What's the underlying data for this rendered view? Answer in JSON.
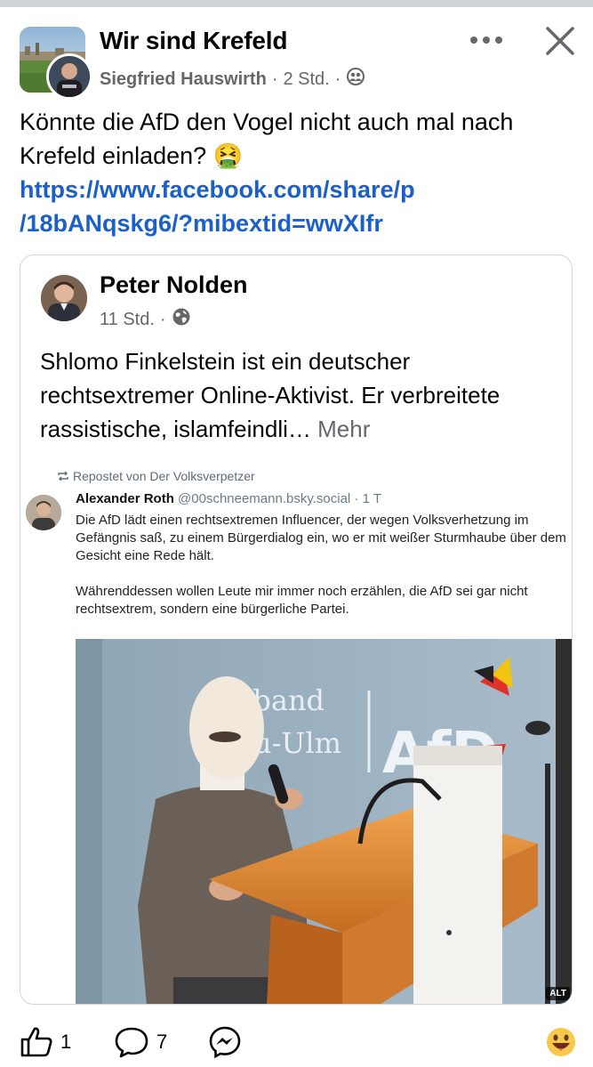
{
  "header": {
    "group_name": "Wir sind Krefeld",
    "author": "Siegfried Hauswirth",
    "time": "2 Std.",
    "dot": "·",
    "privacy_icon": "group-icon",
    "more_icon": "more-icon",
    "close_icon": "close-icon"
  },
  "post": {
    "text": "Könnte die AfD den Vogel nicht auch mal nach Krefeld einladen? 🤮",
    "link_line1": "https://www.facebook.com/share/p",
    "link_line2": "/18bANqskg6/?mibextid=wwXIfr"
  },
  "shared": {
    "author": "Peter Nolden",
    "time": "11 Std.",
    "dot": "·",
    "privacy_icon": "globe-icon",
    "text": "Shlomo Finkelstein ist ein deutscher rechtsextremer Online-Aktivist. Er verbreitete rassistische, islamfeindli…",
    "more": "Mehr"
  },
  "bsky": {
    "repost": "Repostet von Der Volksverpetzer",
    "name": "Alexander Roth",
    "handle": "@00schneemann.bsky.social · 1 T",
    "body": "Die AfD lädt einen rechtsextremen Influencer, der wegen Volksverhetzung im Gefängnis saß, zu einem Bürgerdialog ein, wo er mit weißer Sturmhaube über dem Gesicht eine Rede hält.\n\nWährenddessen wollen Leute mir immer noch erzählen, die AfD sei gar nicht rechtsextrem, sondern eine bürgerliche Partei.",
    "photo": {
      "banner_line1": "K      rband",
      "banner_line2": "u-Ulm",
      "banner_logo": "AfD",
      "alt": "ALT"
    }
  },
  "actions": {
    "like_count": "1",
    "comment_count": "7",
    "share_icon": "messenger-icon",
    "reaction_icon": "emoji-icon"
  },
  "colors": {
    "link": "#1b5fc9",
    "meta": "#65676b",
    "border": "#d0d3d8"
  }
}
